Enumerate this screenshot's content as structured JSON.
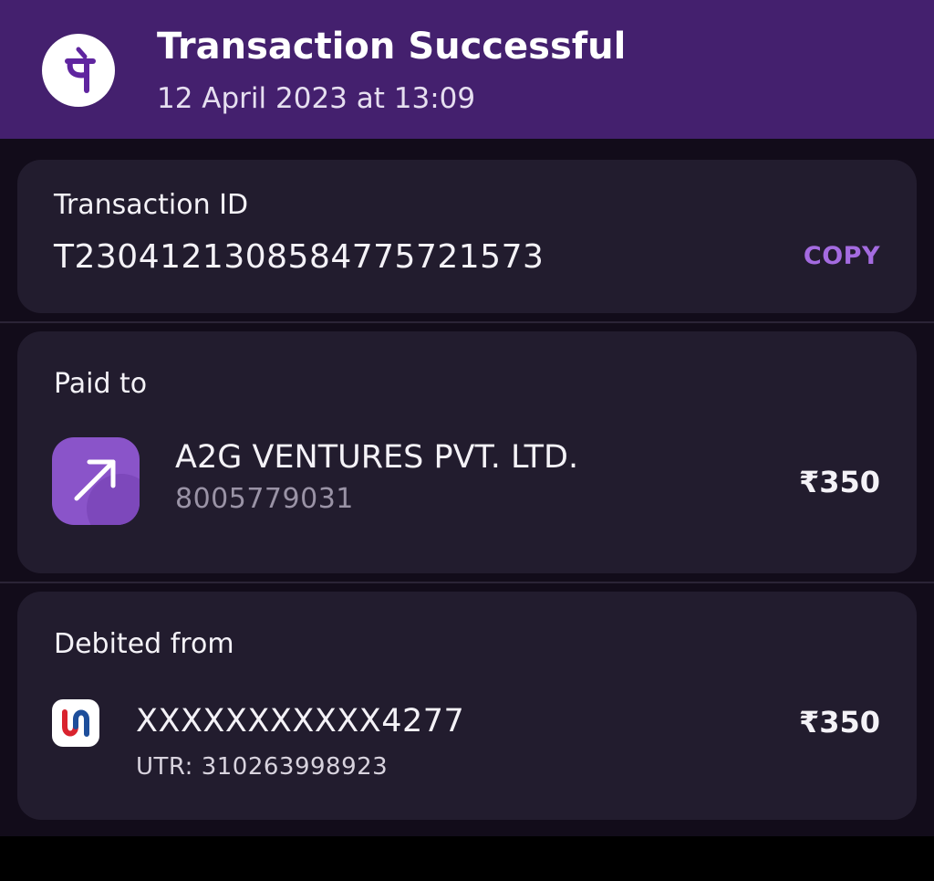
{
  "header": {
    "title": "Transaction Successful",
    "date": "12 April 2023 at 13:09",
    "logo_icon": "phonepe-logo-icon",
    "background": "#44206e"
  },
  "transaction": {
    "label": "Transaction ID",
    "id": "T2304121308584775721573",
    "copy_label": "COPY"
  },
  "paid_to": {
    "label": "Paid to",
    "icon": "arrow-up-right-icon",
    "name": "A2G VENTURES PVT. LTD.",
    "phone": "8005779031",
    "amount": "₹350"
  },
  "debited_from": {
    "label": "Debited from",
    "bank_icon": "union-bank-logo-icon",
    "account": "XXXXXXXXXXX4277",
    "utr": "UTR: 310263998923",
    "amount": "₹350"
  },
  "colors": {
    "accent": "#a46be0",
    "card": "#221c2e",
    "background": "#120c1a"
  }
}
